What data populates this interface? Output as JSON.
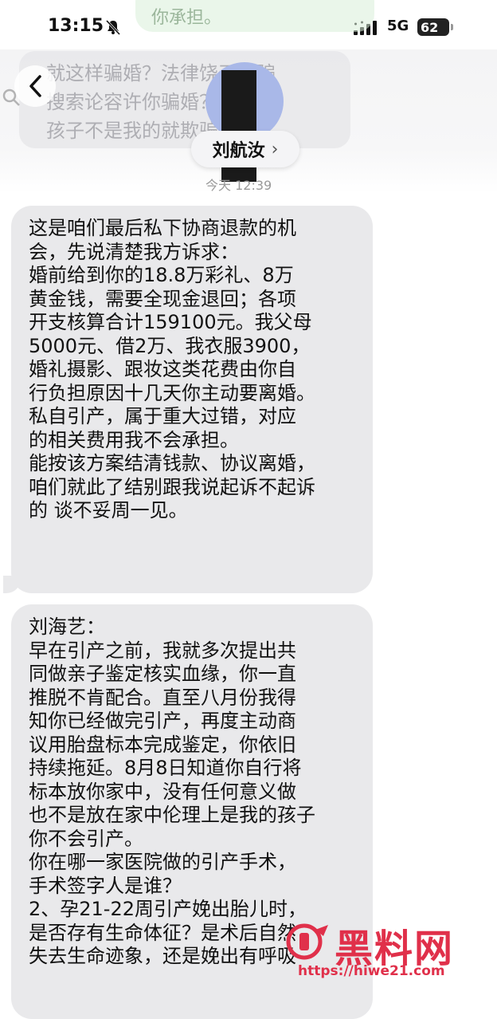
{
  "status_bar": {
    "time": "13:15",
    "network": "5G",
    "battery": "62"
  },
  "top_partial": {
    "text": "你承担。"
  },
  "header": {
    "ghost_text": [
      "就这样骗婚？法律饶了你骗",
      "搜索论容许你骗婚？明知道",
      "孩子不是我的就欺骗婚"
    ],
    "avatar_initial": "刘",
    "contact_name": "刘航汝",
    "chevron": "›",
    "timestamp": "今天 12:39"
  },
  "messages": [
    {
      "lines": [
        "这是咱们最后私下协商退款的机",
        "会，先说清楚我方诉求：",
        "婚前给到你的18.8万彩礼、8万",
        "黄金钱，需要全现金退回；各项",
        "开支核算合计159100元。我父母",
        " 5000元、借2万、我衣服3900，",
        "婚礼摄影、跟妆这类花费由你自",
        "行负担原因十几天你主动要离婚。",
        "私自引产，属于重大过错，对应",
        "的相关费用我不会承担。",
        "能按该方案结清钱款、协议离婚，",
        "咱们就此了结别跟我说起诉不起诉",
        "的 谈不妥周一见。"
      ]
    },
    {
      "lines": [
        "刘海艺：",
        "早在引产之前，我就多次提出共",
        "同做亲子鉴定核实血缘，你一直",
        "推脱不肯配合。直至八月份我得",
        "知你已经做完引产，再度主动商",
        "议用胎盘标本完成鉴定，你依旧",
        "持续拖延。8月8日知道你自行将",
        "标本放你家中，没有任何意义做",
        "也不是放在家中伦理上是我的孩子",
        "你不会引产。",
        "你在哪一家医院做的引产手术，",
        "手术签字人是谁？",
        "2、孕21-22周引产娩出胎儿时，",
        "是否存有生命体征？是术后自然",
        "失去生命迹象，还是娩出有呼吸"
      ]
    }
  ],
  "watermark": {
    "text": "黑料网",
    "url": "https://hiwe21.com"
  }
}
